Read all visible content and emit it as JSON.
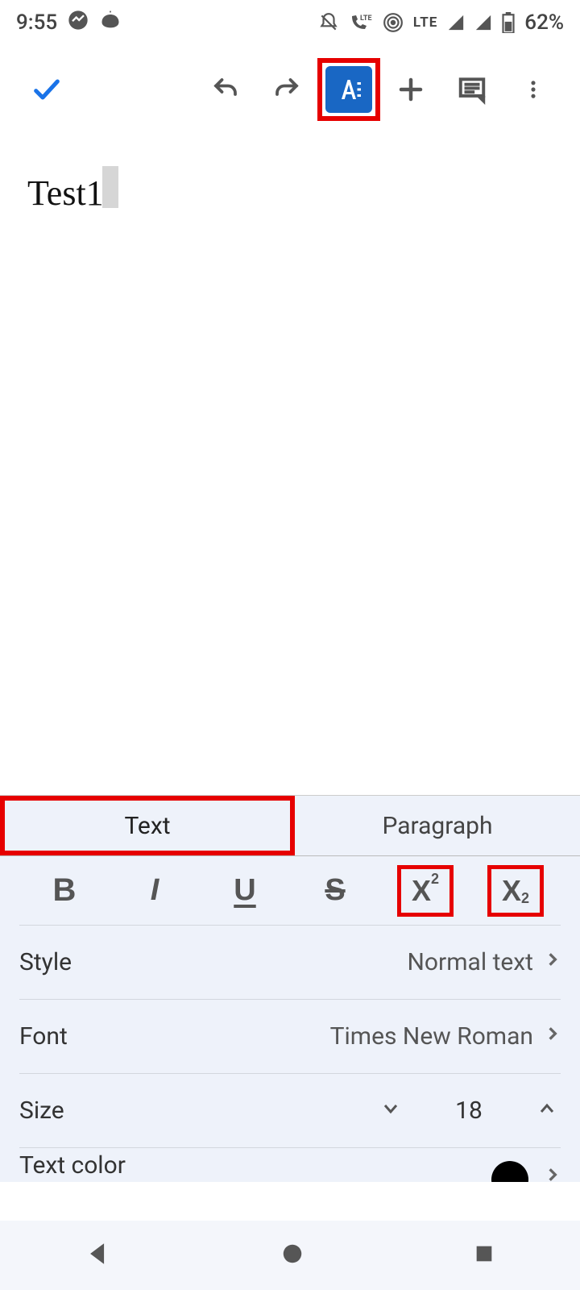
{
  "statusbar": {
    "time": "9:55",
    "lte": "LTE",
    "battery": "62%"
  },
  "document": {
    "text": "Test1"
  },
  "tabs": {
    "text": "Text",
    "paragraph": "Paragraph"
  },
  "fmt": {
    "bold": "B",
    "italic": "I",
    "underline": "U",
    "strike": "S",
    "sup_x": "X",
    "sup_2": "2",
    "sub_x": "X",
    "sub_2": "2"
  },
  "rows": {
    "style_label": "Style",
    "style_value": "Normal text",
    "font_label": "Font",
    "font_value": "Times New Roman",
    "size_label": "Size",
    "size_value": "18",
    "textcolor_label": "Text color"
  }
}
